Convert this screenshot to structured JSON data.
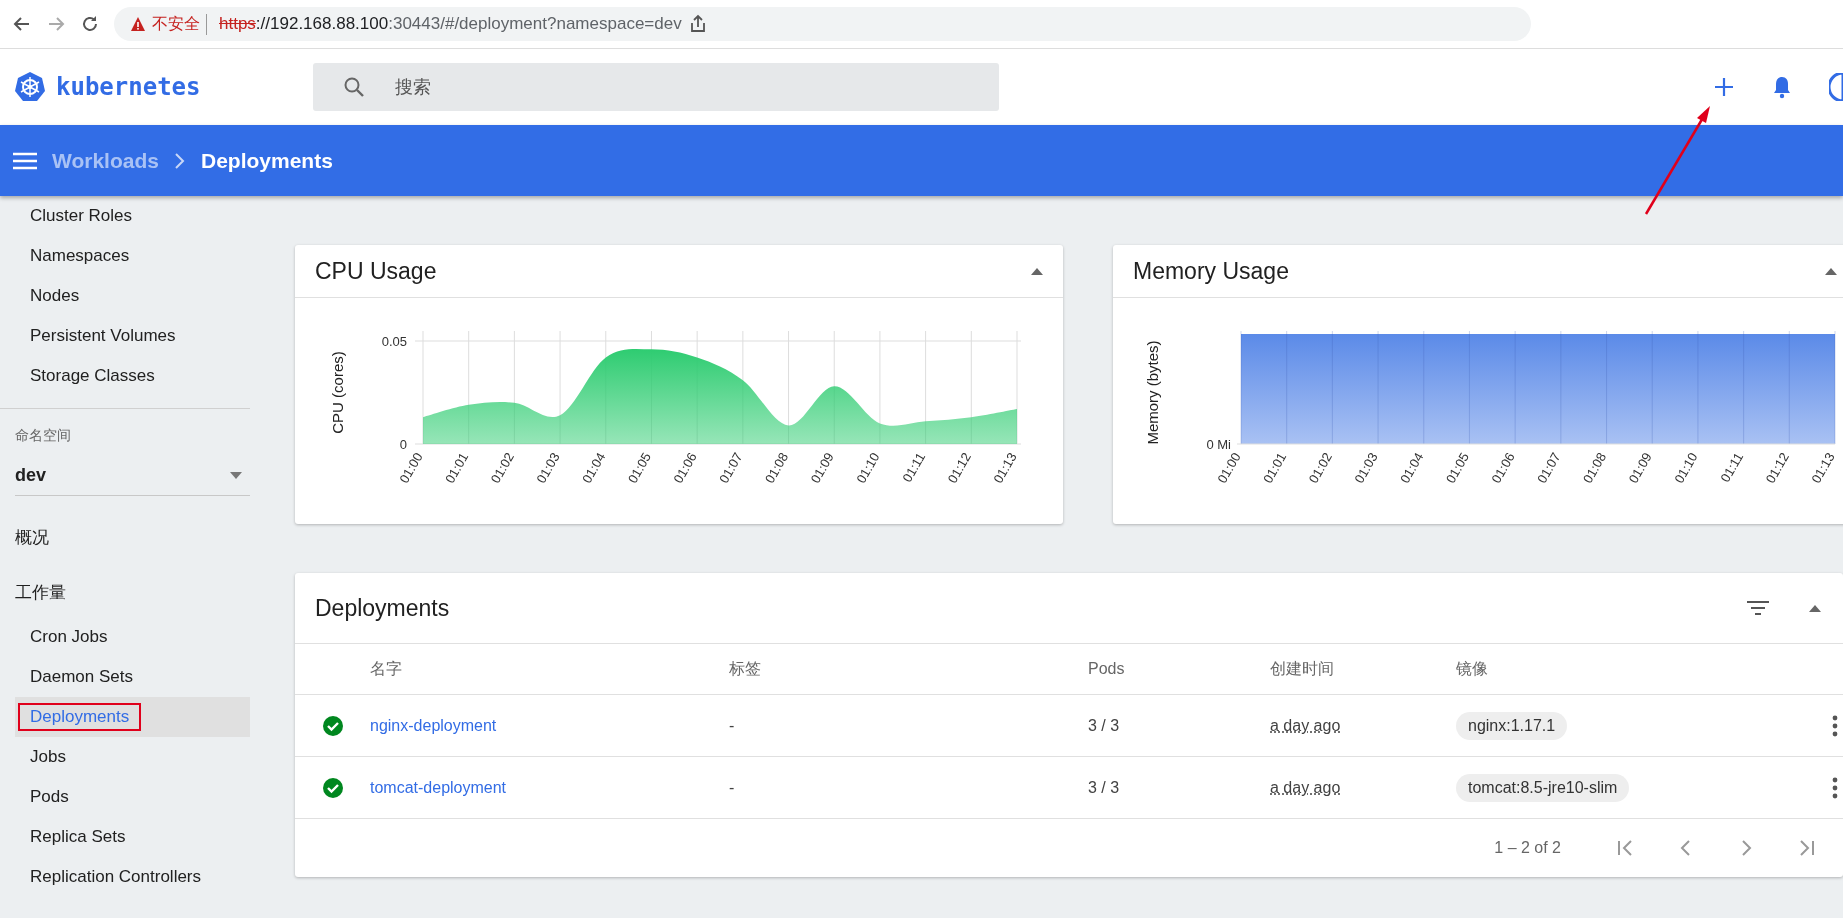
{
  "browser": {
    "security_label": "不安全",
    "url": [
      {
        "kind": "scheme",
        "text": "https"
      },
      {
        "kind": "host",
        "text": "://192.168.88.100"
      },
      {
        "kind": "path",
        "text": ":30443/#/deployment?namespace=dev"
      }
    ]
  },
  "header": {
    "logo_text": "kubernetes",
    "search": {
      "placeholder": "搜索"
    }
  },
  "toolbar": {
    "breadcrumbs": [
      {
        "label": "Workloads",
        "current": false
      },
      {
        "label": "Deployments",
        "current": true
      }
    ]
  },
  "sidebar": {
    "cluster_items": [
      {
        "label": "Cluster Roles",
        "selected": false
      },
      {
        "label": "Namespaces",
        "selected": false
      },
      {
        "label": "Nodes",
        "selected": false
      },
      {
        "label": "Persistent Volumes",
        "selected": false
      },
      {
        "label": "Storage Classes",
        "selected": false
      }
    ],
    "namespace": {
      "label": "命名空间",
      "value": "dev"
    },
    "overview": "概况",
    "workloads": {
      "title": "工作量",
      "items": [
        {
          "label": "Cron Jobs",
          "selected": false,
          "highlighted": false
        },
        {
          "label": "Daemon Sets",
          "selected": false,
          "highlighted": false
        },
        {
          "label": "Deployments",
          "selected": true,
          "highlighted": true
        },
        {
          "label": "Jobs",
          "selected": false,
          "highlighted": false
        },
        {
          "label": "Pods",
          "selected": false,
          "highlighted": false
        },
        {
          "label": "Replica Sets",
          "selected": false,
          "highlighted": false
        },
        {
          "label": "Replication Controllers",
          "selected": false,
          "highlighted": false
        }
      ]
    }
  },
  "cpu_card": {
    "title": "CPU Usage",
    "expanded": true,
    "chart_data": {
      "type": "area",
      "ylabel": "CPU (cores)",
      "categories": [
        "01:00",
        "01:01",
        "01:02",
        "01:03",
        "01:04",
        "01:05",
        "01:06",
        "01:07",
        "01:08",
        "01:09",
        "01:10",
        "01:11",
        "01:12",
        "01:13"
      ],
      "series": [
        {
          "color": "#2ecc71",
          "values": [
            0.013,
            0.019,
            0.02,
            0.014,
            0.042,
            0.046,
            0.042,
            0.031,
            0.009,
            0.028,
            0.01,
            0.011,
            0.013,
            0.017
          ]
        }
      ],
      "ylim": [
        0,
        0.05
      ],
      "yticks": [
        0,
        0.05
      ],
      "grid": true
    }
  },
  "memory_card": {
    "title": "Memory Usage",
    "expanded": true,
    "chart": {
      "ylabel": "Memory (bytes)",
      "ytick_label": "0 Mi",
      "x_labels": [
        "01:00",
        "01:01",
        "01:02",
        "01:03",
        "01:04",
        "01:05",
        "01:06",
        "01:07",
        "01:08",
        "01:09",
        "01:10",
        "01:11",
        "01:12",
        "01:13"
      ]
    }
  },
  "deployments": {
    "title": "Deployments",
    "expanded": true,
    "columns": [
      "名字",
      "标签",
      "Pods",
      "创建时间",
      "镜像"
    ],
    "rows": [
      {
        "healthy": true,
        "name": "nginx-deployment",
        "labels": "-",
        "pods": "3 / 3",
        "created": "a day ago",
        "images": [
          "nginx:1.17.1"
        ]
      },
      {
        "healthy": true,
        "name": "tomcat-deployment",
        "labels": "-",
        "pods": "3 / 3",
        "created": "a day ago",
        "images": [
          "tomcat:8.5-jre10-slim"
        ]
      }
    ],
    "pagination": {
      "range": "1 – 2 of 2"
    }
  },
  "annotations": [
    {
      "kind": "arrow"
    }
  ]
}
